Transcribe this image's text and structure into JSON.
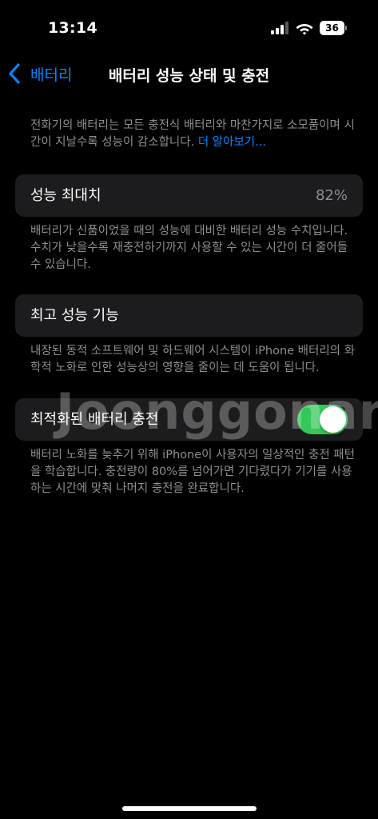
{
  "status_bar": {
    "time": "13:14",
    "battery_level": "36",
    "icons": [
      "cellular-signal-icon",
      "wifi-icon",
      "battery-icon"
    ]
  },
  "nav": {
    "back_label": "배터리",
    "title": "배터리 성능 상태 및 충전"
  },
  "intro": {
    "text": "전화기의 배터리는 모든 충전식 배터리와 마찬가지로 소모품이며 시간이 지날수록 성능이 감소합니다. ",
    "link": "더 알아보기..."
  },
  "max_capacity": {
    "label": "성능 최대치",
    "value": "82%",
    "footer": "배터리가 신품이었을 때의 성능에 대비한 배터리 성능 수치입니다. 수치가 낮을수록 재충전하기까지 사용할 수 있는 시간이 더 줄어들 수 있습니다."
  },
  "peak_performance": {
    "label": "최고 성능 기능",
    "footer": "내장된 동적 소프트웨어 및 하드웨어 시스템이 iPhone 배터리의 화학적 노화로 인한 성능상의 영향을 줄이는 데 도움이 됩니다."
  },
  "optimized_charging": {
    "label": "최적화된 배터리 충전",
    "enabled": true,
    "footer": "배터리 노화를 늦추기 위해 iPhone이 사용자의 일상적인 충전 패턴을 학습합니다. 충전량이 80%를 넘어가면 기다렸다가 기기를 사용하는 시간에 맞춰 나머지 충전을 완료합니다."
  },
  "watermark": "Joonggonara",
  "colors": {
    "background": "#000000",
    "cell": "#1c1c1e",
    "accent": "#0a84ff",
    "toggle_on": "#34c759",
    "secondary_text": "#8e8e93"
  }
}
